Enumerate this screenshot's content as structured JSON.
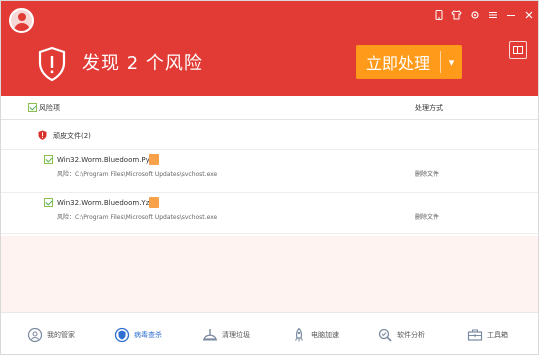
{
  "header": {
    "app_title": "",
    "app_subtitle": "",
    "risk_title": "发现 2 个风险",
    "action_button": "立即处理",
    "action_caret": "▾"
  },
  "window_controls": [
    "phone-icon",
    "shirt-icon",
    "gear-icon",
    "menu-icon",
    "minimize-icon",
    "close-icon"
  ],
  "columns": {
    "risk": "风险项",
    "handle": "处理方式"
  },
  "group": {
    "label": "顽皮文件(2)"
  },
  "items": [
    {
      "name": "Win32.Worm.Bluedoom.Pyze",
      "tag": "",
      "path": "风险：C:\\Program Files\\Microsoft Updates\\svchost.exe",
      "desc": "",
      "action": "删除文件"
    },
    {
      "name": "Win32.Worm.Bluedoom.Yzct",
      "tag": "",
      "path": "风险：C:\\Program Files\\Microsoft Updates\\svchost.exe",
      "desc": "",
      "action": "删除文件"
    }
  ],
  "nav": [
    {
      "label": "我的管家",
      "icon": "home-icon"
    },
    {
      "label": "病毒查杀",
      "icon": "shield-scan-icon",
      "active": true
    },
    {
      "label": "清理垃圾",
      "icon": "broom-icon"
    },
    {
      "label": "电脑加速",
      "icon": "rocket-icon"
    },
    {
      "label": "软件分析",
      "icon": "magnifier-icon"
    },
    {
      "label": "工具箱",
      "icon": "toolbox-icon"
    }
  ],
  "colors": {
    "header_red": "#e23b35",
    "action_orange": "#ff9a1a",
    "tag_orange": "#f7a24a",
    "active_blue": "#2f6fd1"
  }
}
